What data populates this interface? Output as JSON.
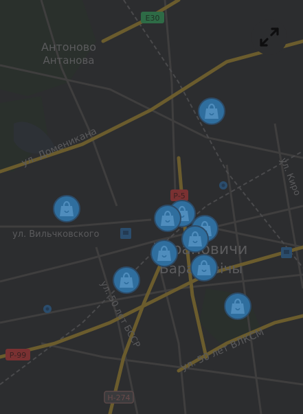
{
  "map": {
    "labels": {
      "antonovo_ru": "Антоново",
      "antonovo_by": "Антанова",
      "street_domenikana": "ул. Доменикана",
      "street_vilchkovskogo": "ул. Вильчковского",
      "street_50_let_bssr": "ул. 50 лет БССР",
      "street_50_let_vlksm": "ул. 50 лет ВЛКСМ",
      "street_kirova": "ул. Киро",
      "city_ru": "Барановичи",
      "city_by": "Баранавічы"
    },
    "road_badges": {
      "e30": "E30",
      "p5": "Р-5",
      "p99": "Р-99",
      "h274": "Н-274"
    },
    "icons": {
      "expand": "expand-arrows-icon",
      "store_marker": "shopping-bag-marker-icon",
      "transit_marker": "train-station-icon",
      "bus_stop": "stop-point-icon"
    },
    "colors": {
      "background": "#2c2d2f",
      "major_road": "#6f5f2c",
      "minor_road": "#454343",
      "marker": "#2f6e9e",
      "green_badge": "#2e6b46",
      "red_badge": "#7a3132"
    }
  }
}
